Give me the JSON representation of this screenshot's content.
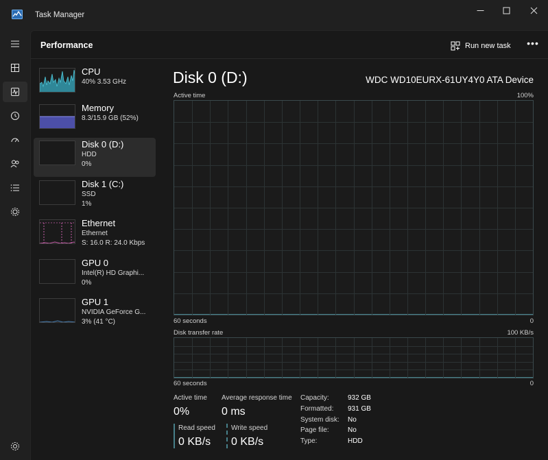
{
  "window": {
    "title": "Task Manager",
    "controls": {
      "minimize": "—",
      "maximize": "☐",
      "close": "✕"
    }
  },
  "nav": {
    "icons": [
      "menu-icon",
      "processes-icon",
      "performance-icon",
      "app-history-icon",
      "startup-apps-icon",
      "users-icon",
      "details-icon",
      "services-icon"
    ],
    "settings_icon": "settings-icon",
    "accent": "#3b3b3b"
  },
  "header": {
    "title": "Performance",
    "run_new_task": "Run new task",
    "more": "•••"
  },
  "perf_items": [
    {
      "name": "CPU",
      "sub1": "40% 3.53 GHz",
      "sub2": "",
      "color": "#3aa2b1"
    },
    {
      "name": "Memory",
      "sub1": "8.3/15.9 GB (52%)",
      "sub2": "",
      "color": "#6b6fd6"
    },
    {
      "name": "Disk 0 (D:)",
      "sub1": "HDD",
      "sub2": "0%",
      "color": "#4e8e78"
    },
    {
      "name": "Disk 1 (C:)",
      "sub1": "SSD",
      "sub2": "1%",
      "color": "#4e8e78"
    },
    {
      "name": "Ethernet",
      "sub1": "Ethernet",
      "sub2": "S: 16.0  R: 24.0 Kbps",
      "color": "#c55ea9"
    },
    {
      "name": "GPU 0",
      "sub1": "Intel(R) HD Graphi...",
      "sub2": "0%",
      "color": "#4d83b8"
    },
    {
      "name": "GPU 1",
      "sub1": "NVIDIA GeForce G...",
      "sub2": "3% (41 °C)",
      "color": "#4d83b8"
    }
  ],
  "detail": {
    "title": "Disk 0 (D:)",
    "device": "WDC WD10EURX-61UY4Y0 ATA Device",
    "active_time_label": "Active time",
    "active_time_max": "100%",
    "time_axis_1": "60 seconds",
    "zero_1": "0",
    "transfer_label": "Disk transfer rate",
    "transfer_max": "100 KB/s",
    "time_axis_2": "60 seconds",
    "zero_2": "0",
    "accent": "#47808a"
  },
  "stats": {
    "active_time_label": "Active time",
    "active_time_value": "0%",
    "avg_response_label": "Average response time",
    "avg_response_value": "0 ms",
    "read_label": "Read speed",
    "read_value": "0 KB/s",
    "write_label": "Write speed",
    "write_value": "0 KB/s",
    "read_color": "#47808a",
    "write_color": "#47808a"
  },
  "properties": [
    {
      "key": "Capacity:",
      "value": "932 GB"
    },
    {
      "key": "Formatted:",
      "value": "931 GB"
    },
    {
      "key": "System disk:",
      "value": "No"
    },
    {
      "key": "Page file:",
      "value": "No"
    },
    {
      "key": "Type:",
      "value": "HDD"
    }
  ]
}
